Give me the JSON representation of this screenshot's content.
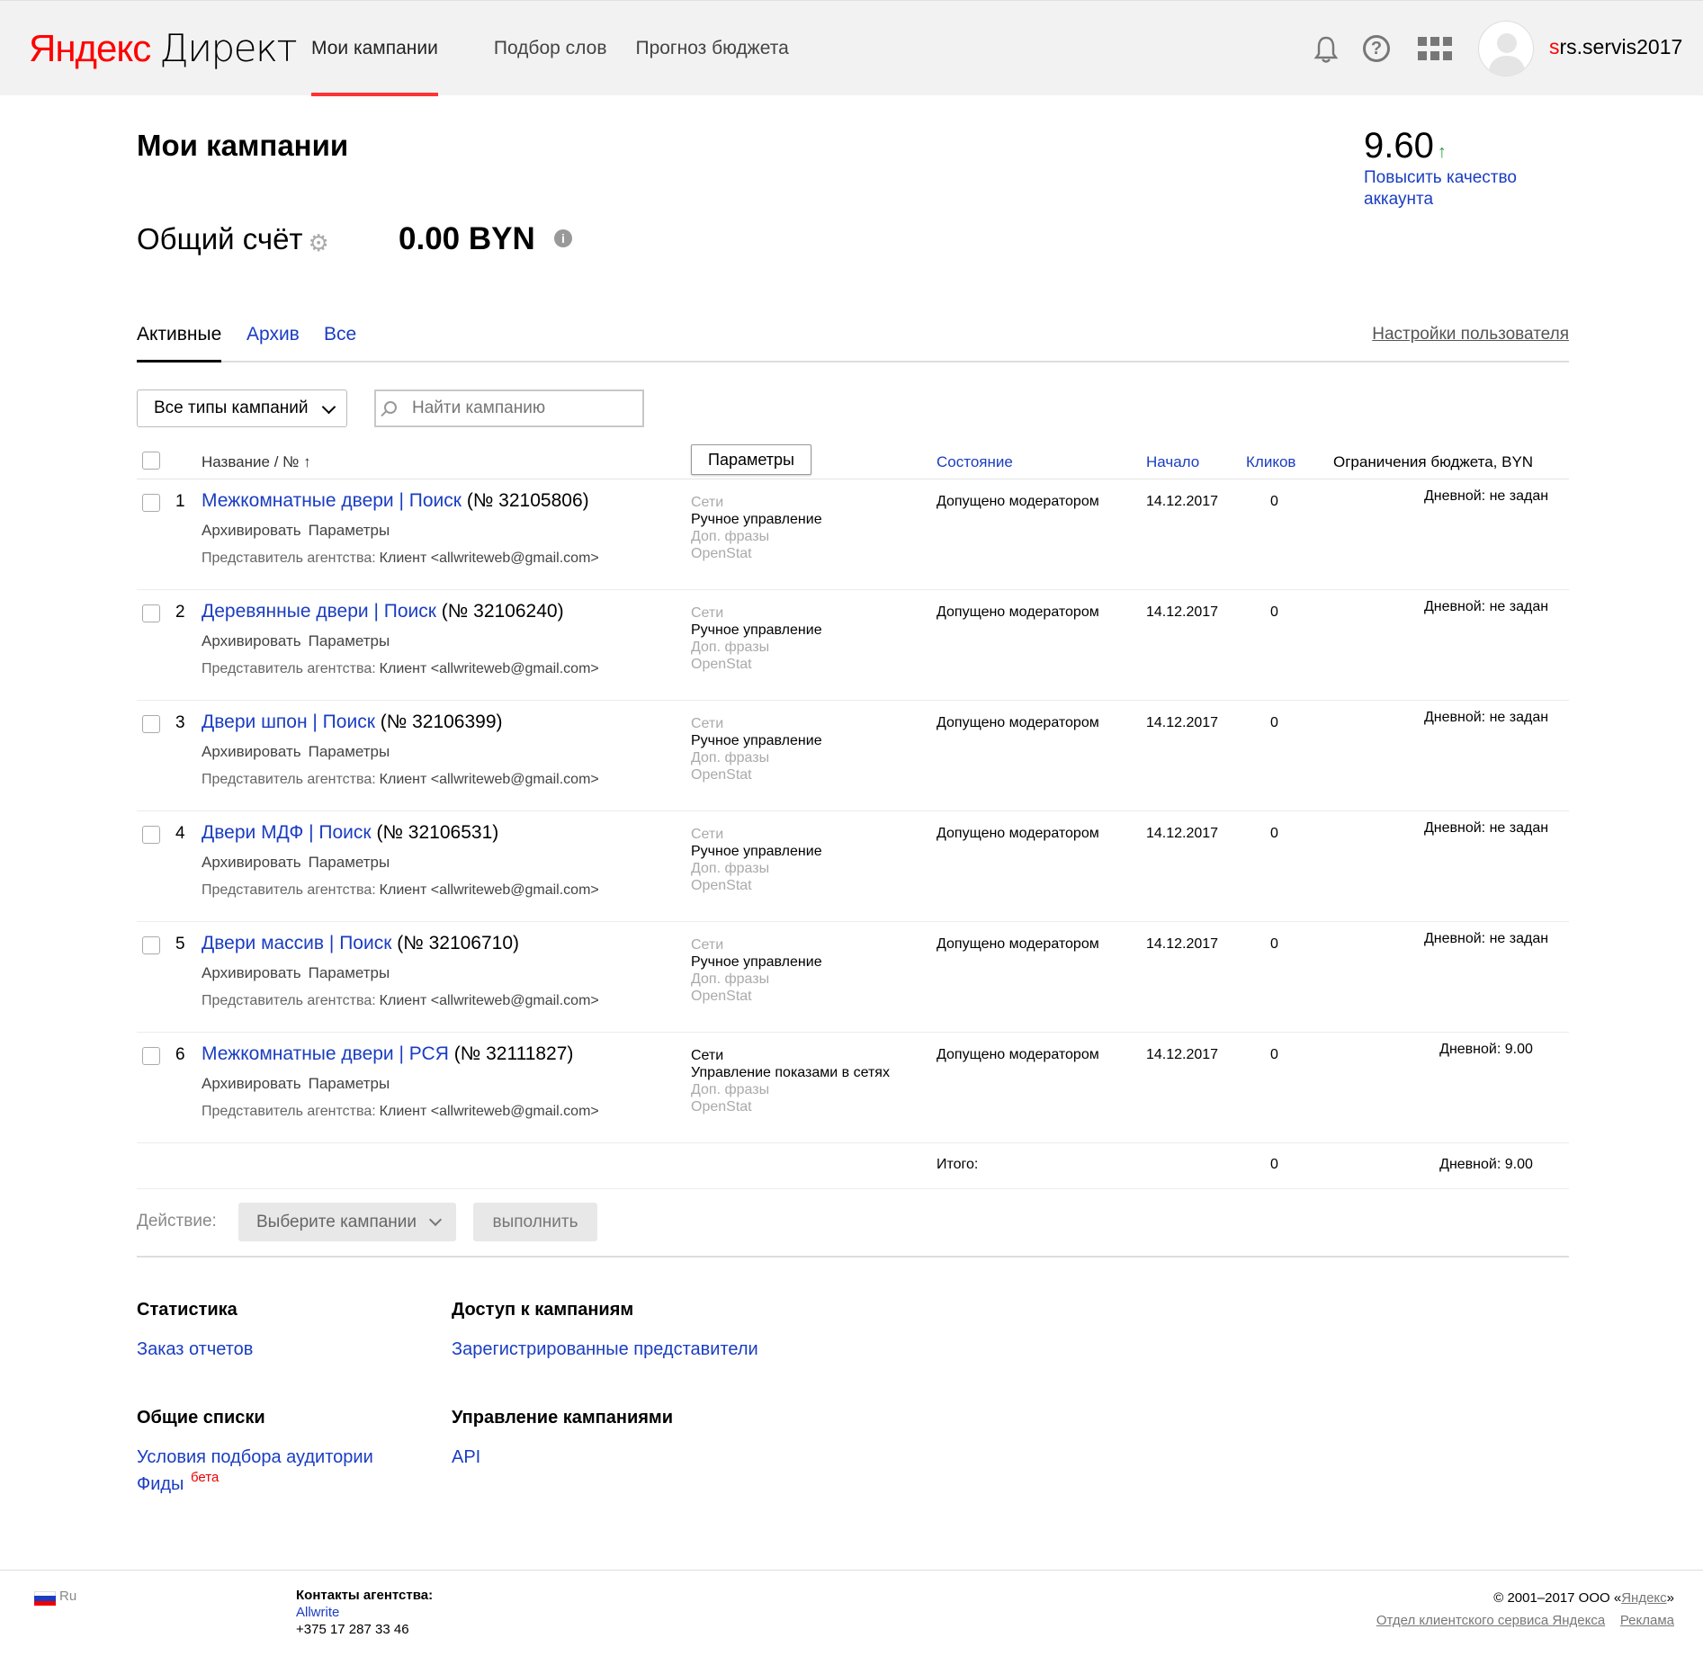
{
  "header": {
    "logo_yandex": "Яндекс",
    "logo_direct": "Директ",
    "nav": [
      {
        "label": "Мои кампании",
        "active": true
      },
      {
        "label": "Подбор слов",
        "active": false
      },
      {
        "label": "Прогноз бюджета",
        "active": false
      }
    ],
    "username_first": "s",
    "username_rest": "rs.servis2017",
    "icons": [
      "bell-icon",
      "help-icon",
      "apps-grid-icon",
      "avatar"
    ]
  },
  "page": {
    "title": "Мои кампании",
    "quality_score": "9.60",
    "quality_arrow": "↑",
    "quality_link": "Повысить качество аккаунта",
    "account_label": "Общий счёт",
    "balance": "0.00 BYN"
  },
  "tabs": [
    {
      "label": "Активные",
      "active": true
    },
    {
      "label": "Архив",
      "active": false
    },
    {
      "label": "Все",
      "active": false
    }
  ],
  "user_settings": "Настройки пользователя",
  "filters": {
    "type_select": "Все типы кампаний",
    "search_placeholder": "Найти кампанию"
  },
  "table": {
    "headers": {
      "name": "Название / № ↑",
      "params_button": "Параметры",
      "state": "Состояние",
      "start": "Начало",
      "clicks": "Кликов",
      "budget": "Ограничения бюджета, BYN"
    },
    "rows": [
      {
        "num": "1",
        "name": "Межкомнатные двери | Поиск",
        "id": "(№ 32105806)",
        "archive": "Архивировать",
        "params": "Параметры",
        "rep_label": "Представитель агентства:",
        "client": "Клиент <allwriteweb@gmail.com>",
        "nets": "Сети",
        "strategy": "Ручное управление",
        "phrases": "Доп. фразы",
        "openstat": "OpenStat",
        "state": "Допущено модератором",
        "date": "14.12.2017",
        "clicks": "0",
        "budget": "Дневной: не задан"
      },
      {
        "num": "2",
        "name": "Деревянные двери | Поиск",
        "id": "(№ 32106240)",
        "archive": "Архивировать",
        "params": "Параметры",
        "rep_label": "Представитель агентства:",
        "client": "Клиент <allwriteweb@gmail.com>",
        "nets": "Сети",
        "strategy": "Ручное управление",
        "phrases": "Доп. фразы",
        "openstat": "OpenStat",
        "state": "Допущено модератором",
        "date": "14.12.2017",
        "clicks": "0",
        "budget": "Дневной: не задан"
      },
      {
        "num": "3",
        "name": "Двери шпон | Поиск",
        "id": "(№ 32106399)",
        "archive": "Архивировать",
        "params": "Параметры",
        "rep_label": "Представитель агентства:",
        "client": "Клиент <allwriteweb@gmail.com>",
        "nets": "Сети",
        "strategy": "Ручное управление",
        "phrases": "Доп. фразы",
        "openstat": "OpenStat",
        "state": "Допущено модератором",
        "date": "14.12.2017",
        "clicks": "0",
        "budget": "Дневной: не задан"
      },
      {
        "num": "4",
        "name": "Двери МДФ | Поиск",
        "id": "(№ 32106531)",
        "archive": "Архивировать",
        "params": "Параметры",
        "rep_label": "Представитель агентства:",
        "client": "Клиент <allwriteweb@gmail.com>",
        "nets": "Сети",
        "strategy": "Ручное управление",
        "phrases": "Доп. фразы",
        "openstat": "OpenStat",
        "state": "Допущено модератором",
        "date": "14.12.2017",
        "clicks": "0",
        "budget": "Дневной: не задан"
      },
      {
        "num": "5",
        "name": "Двери массив | Поиск",
        "id": "(№ 32106710)",
        "archive": "Архивировать",
        "params": "Параметры",
        "rep_label": "Представитель агентства:",
        "client": "Клиент <allwriteweb@gmail.com>",
        "nets": "Сети",
        "strategy": "Ручное управление",
        "phrases": "Доп. фразы",
        "openstat": "OpenStat",
        "state": "Допущено модератором",
        "date": "14.12.2017",
        "clicks": "0",
        "budget": "Дневной: не задан"
      },
      {
        "num": "6",
        "name": "Межкомнатные двери | РСЯ",
        "id": "(№ 32111827)",
        "archive": "Архивировать",
        "params": "Параметры",
        "rep_label": "Представитель агентства:",
        "client": "Клиент <allwriteweb@gmail.com>",
        "nets": "Сети",
        "strategy": "Управление показами в сетях",
        "phrases": "Доп. фразы",
        "openstat": "OpenStat",
        "state": "Допущено модератором",
        "date": "14.12.2017",
        "clicks": "0",
        "budget": "Дневной: 9.00",
        "nets_dark": true
      }
    ],
    "total": {
      "label": "Итого:",
      "clicks": "0",
      "budget": "Дневной: 9.00"
    }
  },
  "actions": {
    "label": "Действие:",
    "select": "Выберите кампании",
    "run": "выполнить"
  },
  "sections": {
    "stats_h": "Статистика",
    "stats_link": "Заказ отчетов",
    "access_h": "Доступ к кампаниям",
    "access_link": "Зарегистрированные представители",
    "lists_h": "Общие списки",
    "lists_link1": "Условия подбора аудитории",
    "lists_link2": "Фиды",
    "beta": "бета",
    "manage_h": "Управление кампаниями",
    "manage_link": "API"
  },
  "footer": {
    "lang": "Ru",
    "contacts_h": "Контакты агентства:",
    "agency": "Allwrite",
    "phone": "+375 17 287 33 46",
    "copyright_prefix": "© 2001–2017  ООО «",
    "copyright_link": "Яндекс",
    "copyright_suffix": "»",
    "support": "Отдел клиентского сервиса Яндекса",
    "ads": "Реклама"
  },
  "colors": {
    "accent_red": "#ff3333",
    "link_blue": "#1a3dc1",
    "quality_green": "#2a9d3b"
  }
}
